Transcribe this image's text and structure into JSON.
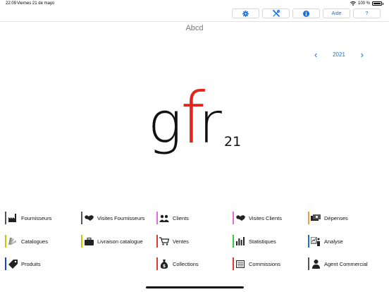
{
  "statusbar": {
    "time": "22:09",
    "date": "Viernes 21 de mayo",
    "battery": "100 %"
  },
  "toolbar": {
    "buttons": [
      {
        "name": "settings",
        "icon": "gear-icon"
      },
      {
        "name": "tools",
        "icon": "tools-icon"
      },
      {
        "name": "info",
        "icon": "info-icon"
      },
      {
        "name": "help-text",
        "label": "Aide"
      },
      {
        "name": "help",
        "label": "?"
      }
    ]
  },
  "company": "Abcd",
  "year_nav": {
    "year": "2021",
    "prev": "‹",
    "next": "›"
  },
  "logo": {
    "letters": [
      "g",
      "f",
      "r"
    ],
    "suffix": "21",
    "accent_color": "#e4231c"
  },
  "menu": [
    {
      "label": "Fournisseurs",
      "icon": "factory-icon",
      "color": "#555555"
    },
    {
      "label": "Visites Fournisseurs",
      "icon": "handshake-icon",
      "color": "#555555"
    },
    {
      "label": "Clients",
      "icon": "people-icon",
      "color": "#e66bd6"
    },
    {
      "label": "Visites Clients",
      "icon": "handshake-icon",
      "color": "#e66bd6"
    },
    {
      "label": "Dépenses",
      "icon": "money-icon",
      "color": "#f0a030"
    },
    {
      "label": "Catalogues",
      "icon": "swatch-icon",
      "color": "#c8c800"
    },
    {
      "label": "Livraison catalogue",
      "icon": "briefcase-icon",
      "color": "#c8c800"
    },
    {
      "label": "Ventes",
      "icon": "cart-icon",
      "color": "#e03a2e"
    },
    {
      "label": "Statistiques",
      "icon": "barchart-icon",
      "color": "#3cc83c"
    },
    {
      "label": "Analyse",
      "icon": "analysis-icon",
      "color": "#1a6fd9"
    },
    {
      "label": "Produits",
      "icon": "tag-icon",
      "color": "#1a3fd9"
    },
    {
      "label": "Collections",
      "icon": "moneybag-icon",
      "color": "#e03a2e"
    },
    {
      "label": "Commissions",
      "icon": "ledger-icon",
      "color": "#e03a2e"
    },
    {
      "label": "Agent Commercial",
      "icon": "person-icon",
      "color": "#555555"
    }
  ]
}
